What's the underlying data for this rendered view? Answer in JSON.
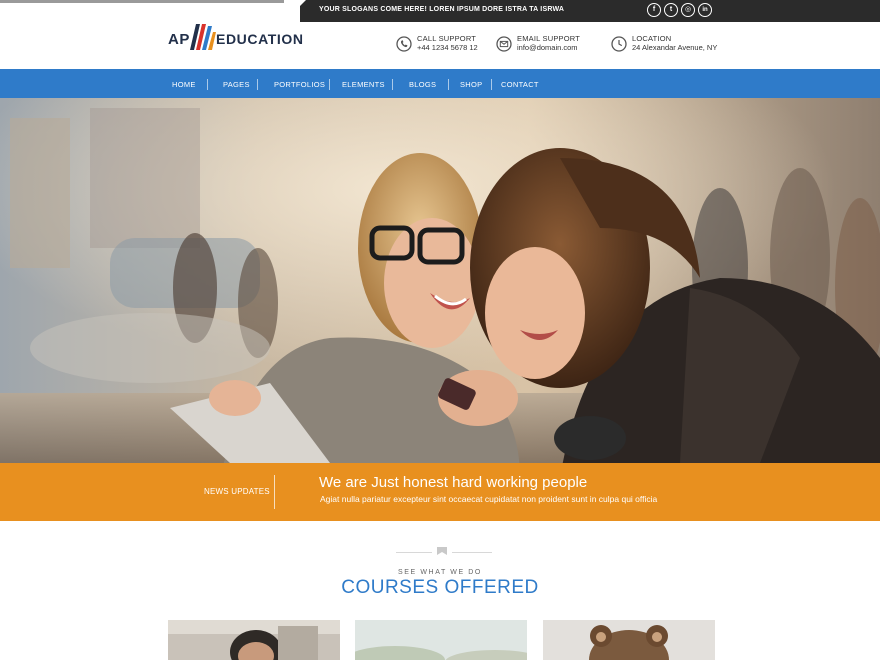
{
  "topbar": {
    "slogan": "YOUR SLOGANS COME HERE! LOREN IPSUM DORE ISTRA TA ISRWA",
    "social": [
      {
        "icon": "facebook-icon",
        "glyph": "f"
      },
      {
        "icon": "twitter-icon",
        "glyph": "t"
      },
      {
        "icon": "instagram-icon",
        "glyph": "◎"
      },
      {
        "icon": "linkedin-icon",
        "glyph": "in"
      }
    ]
  },
  "header": {
    "logo_prefix": "AP",
    "logo_text": "EDUCATION",
    "logo_colors": [
      "#e8901f",
      "#2f7bc9",
      "#d9322b",
      "#22304a"
    ],
    "contacts": [
      {
        "icon": "phone-icon",
        "title": "CALL SUPPORT",
        "value": "+44 1234 5678 12"
      },
      {
        "icon": "email-icon",
        "title": "EMAIL SUPPORT",
        "value": "info@domain.com"
      },
      {
        "icon": "location-icon",
        "title": "LOCATION",
        "value": "24 Alexandar Avenue, NY"
      }
    ]
  },
  "nav": {
    "items": [
      "HOME",
      "PAGES",
      "PORTFOLIOS",
      "ELEMENTS",
      "BLOGS",
      "SHOP",
      "CONTACT"
    ]
  },
  "news": {
    "label": "NEWS UPDATES",
    "title": "We are Just honest hard working people",
    "text": "Agiat nulla pariatur excepteur sint occaecat cupidatat non proident sunt in culpa qui officia"
  },
  "courses": {
    "kicker": "SEE WHAT WE DO",
    "title": "COURSES OFFERED"
  },
  "colors": {
    "nav_blue": "#2f7bc9",
    "accent_orange": "#e8901f",
    "topbar_dark": "#2b2b2b",
    "heading_navy": "#22304a"
  }
}
